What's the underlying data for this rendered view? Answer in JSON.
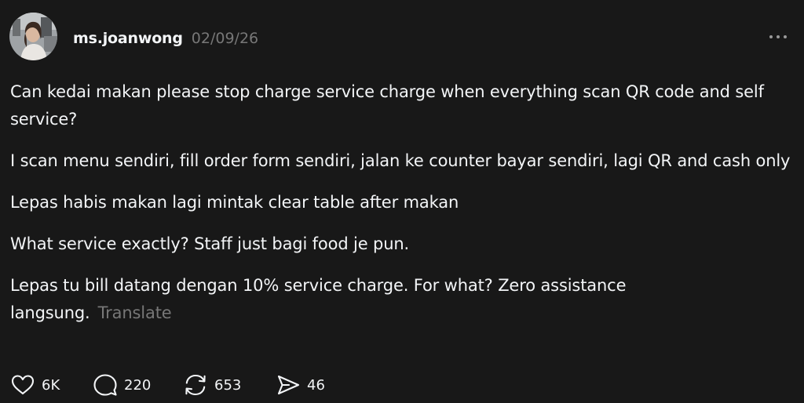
{
  "post": {
    "author": "ms.joanwong",
    "date": "02/09/26",
    "paragraphs": [
      "Can kedai makan please stop charge service charge when everything scan QR code and self service?",
      "I scan menu sendiri, fill order form sendiri, jalan ke counter bayar sendiri, lagi QR and cash only",
      "Lepas habis makan lagi mintak clear table after makan",
      "What service exactly? Staff just bagi food je pun.",
      "Lepas tu bill datang dengan 10% service charge. For what? Zero assistance langsung."
    ],
    "translate_label": "Translate"
  },
  "actions": {
    "likes": "6K",
    "replies": "220",
    "reposts": "653",
    "shares": "46"
  },
  "icons": {
    "like": "heart-icon",
    "reply": "speech-bubble-icon",
    "repost": "repost-icon",
    "share": "send-icon",
    "more": "more-horizontal-icon"
  },
  "colors": {
    "background": "#181818",
    "text": "#f3f5f7",
    "muted": "#777777"
  }
}
